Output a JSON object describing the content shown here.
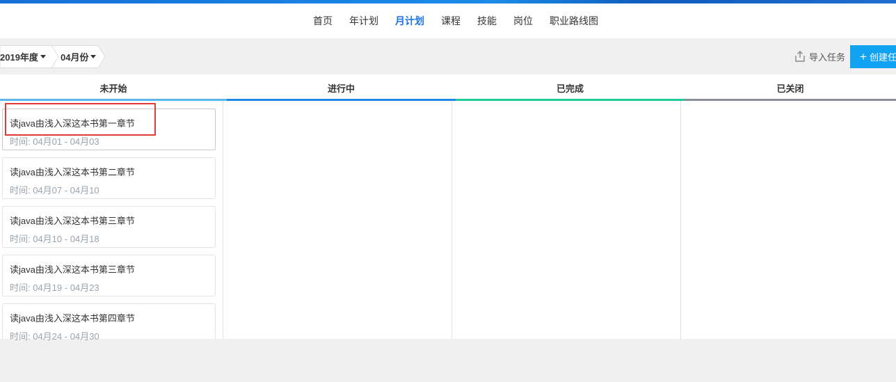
{
  "nav": {
    "items": [
      {
        "label": "首页",
        "active": false
      },
      {
        "label": "年计划",
        "active": false
      },
      {
        "label": "月计划",
        "active": true
      },
      {
        "label": "课程",
        "active": false
      },
      {
        "label": "技能",
        "active": false
      },
      {
        "label": "岗位",
        "active": false
      },
      {
        "label": "职业路线图",
        "active": false
      }
    ]
  },
  "toolbar": {
    "year": "2019年度",
    "month": "04月份",
    "import_label": "导入任务",
    "create_label": "创建任"
  },
  "columns": [
    {
      "title": "未开始",
      "color": "#5ab8ee"
    },
    {
      "title": "进行中",
      "color": "#1e88e5"
    },
    {
      "title": "已完成",
      "color": "#20c997"
    },
    {
      "title": "已关闭",
      "color": "#8a8f99"
    }
  ],
  "tasks": [
    {
      "title": "读java由浅入深这本书第一章节",
      "time": "时间: 04月01 - 04月03"
    },
    {
      "title": "读java由浅入深这本书第二章节",
      "time": "时间: 04月07 - 04月10"
    },
    {
      "title": "读java由浅入深这本书第三章节",
      "time": "时间: 04月10 - 04月18"
    },
    {
      "title": "读java由浅入深这本书第三章节",
      "time": "时间: 04月19 - 04月23"
    },
    {
      "title": "读java由浅入深这本书第四章节",
      "time": "时间: 04月24 - 04月30"
    }
  ],
  "colors": {
    "accent": "#1a73e8",
    "create_button": "#12a2f2",
    "highlight": "#e53935"
  }
}
